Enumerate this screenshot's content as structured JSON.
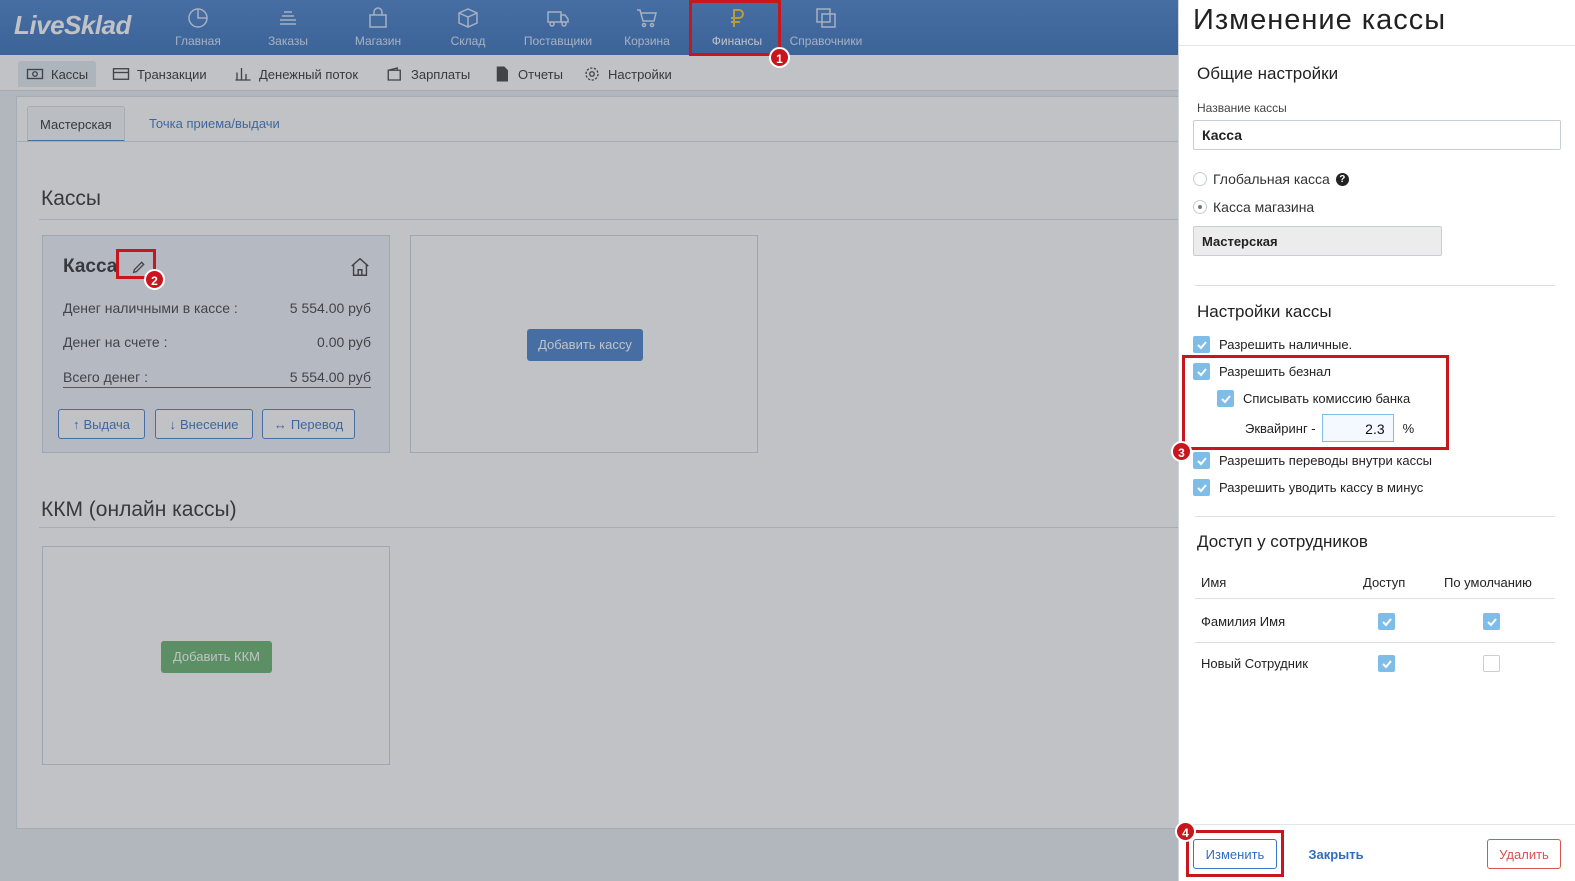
{
  "app": {
    "logo": "LiveSklad",
    "nav": [
      {
        "label": "Главная",
        "icon": "chart-pie-icon"
      },
      {
        "label": "Заказы",
        "icon": "stack-icon"
      },
      {
        "label": "Магазин",
        "icon": "bag-icon"
      },
      {
        "label": "Склад",
        "icon": "box-icon"
      },
      {
        "label": "Поставщики",
        "icon": "truck-icon"
      },
      {
        "label": "Корзина",
        "icon": "cart-icon"
      },
      {
        "label": "Финансы",
        "icon": "ruble-icon",
        "active": true
      },
      {
        "label": "Справочники",
        "icon": "copy-icon"
      }
    ],
    "subnav": [
      {
        "label": "Кассы",
        "icon": "cash-icon",
        "active": true
      },
      {
        "label": "Транзакции",
        "icon": "card-icon"
      },
      {
        "label": "Денежный поток",
        "icon": "bar-chart-icon"
      },
      {
        "label": "Зарплаты",
        "icon": "wallet-icon"
      },
      {
        "label": "Отчеты",
        "icon": "document-icon"
      },
      {
        "label": "Настройки",
        "icon": "gear-icon"
      }
    ],
    "tabs": [
      "Мастерская",
      "Точка приема/выдачи"
    ],
    "kassy_title": "Кассы",
    "kassa_card": {
      "title": "Касса",
      "rows": [
        {
          "label": "Денег наличными в кассе :",
          "value": "5 554.00 руб"
        },
        {
          "label": "Денег на счете :",
          "value": "0.00 руб"
        },
        {
          "label": "Всего денег :",
          "value": "5 554.00 руб"
        }
      ],
      "buttons": [
        "Выдача",
        "Внесение",
        "Перевод"
      ]
    },
    "add_kassa": "Добавить кассу",
    "kkm_title": "ККМ (онлайн кассы)",
    "add_kkm": "Добавить ККМ"
  },
  "panel": {
    "title": "Изменение кассы",
    "general_title": "Общие настройки",
    "name_label": "Название кассы",
    "name_value": "Касса",
    "radio_global": "Глобальная касса",
    "radio_shop": "Касса магазина",
    "shop_value": "Мастерская",
    "settings_title": "Настройки кассы",
    "checks": {
      "cash": "Разрешить наличные.",
      "cashless": "Разрешить безнал",
      "commission": "Списывать комиссию банка",
      "transfers": "Разрешить переводы внутри кассы",
      "minus": "Разрешить уводить кассу в минус"
    },
    "acquiring_label": "Эквайринг -",
    "acquiring_value": "2.3",
    "acquiring_unit": "%",
    "access_title": "Доступ у сотрудников",
    "access_cols": [
      "Имя",
      "Доступ",
      "По умолчанию"
    ],
    "employees": [
      {
        "name": "Фамилия Имя",
        "access": true,
        "default": true
      },
      {
        "name": "Новый Сотрудник",
        "access": true,
        "default": false
      }
    ],
    "footer": {
      "save": "Изменить",
      "close": "Закрыть",
      "delete": "Удалить"
    }
  },
  "annotations": [
    "1",
    "2",
    "3",
    "4"
  ],
  "colors": {
    "brand": "#3a78c6",
    "accent_active": "#f5c31c",
    "annotation": "#c8161e",
    "delete": "#d9534f"
  }
}
